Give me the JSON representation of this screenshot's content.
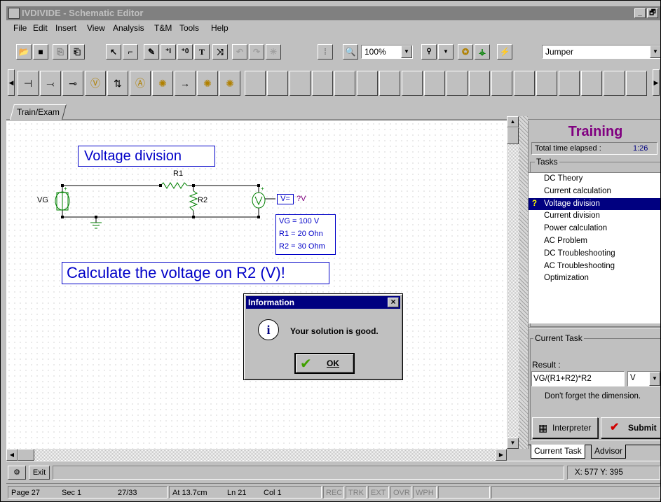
{
  "window": {
    "title": "IVDIVIDE - Schematic Editor",
    "minimize_glyph": "_",
    "maximize_glyph": "🗗"
  },
  "menu": [
    "File",
    "Edit",
    "Insert",
    "View",
    "Analysis",
    "T&M",
    "Tools",
    "Help"
  ],
  "toolbar": {
    "zoom_value": "100%",
    "component_select": "Jumper"
  },
  "tab": {
    "label": "Train/Exam"
  },
  "schematic": {
    "title": "Voltage division",
    "labels": {
      "r1": "R1",
      "r2": "R2",
      "vg": "VG",
      "meter": "V=",
      "unknown": "?V"
    },
    "values": [
      "VG = 100 V",
      "R1 =  20 Ohn",
      "R2 =  30 Ohm"
    ],
    "question": "Calculate the voltage on R2 (V)!"
  },
  "dialog": {
    "title": "Information",
    "message": "Your solution is good.",
    "ok": "OK",
    "close": "×"
  },
  "training": {
    "title": "Training",
    "time_label": "Total time elapsed :",
    "time_value": "1:26",
    "tasks_label": "Tasks",
    "tasks": [
      "DC Theory",
      "Current calculation",
      "Voltage division",
      "Current division",
      "Power calculation",
      "AC Problem",
      "DC Troubleshooting",
      "AC Troubleshooting",
      "Optimization"
    ],
    "selected_task_marker": "?",
    "current_task_label": "Current Task",
    "result_label": "Result :",
    "result_value": "VG/(R1+R2)*R2",
    "unit_value": "V",
    "hint": "Don't forget the dimension.",
    "interpreter": "Interpreter",
    "submit": "Submit",
    "bottom_tabs": [
      "Current Task",
      "Advisor"
    ],
    "colors": {
      "title": "#800080",
      "selected": "#000080"
    }
  },
  "bottombar": {
    "exit": "Exit",
    "coords": "X: 577  Y: 395"
  },
  "statusbar": {
    "page": "Page 27",
    "sec": "Sec 1",
    "pages": "27/33",
    "at": "At 13.7cm",
    "ln": "Ln 21",
    "col": "Col 1",
    "indicators": [
      "REC",
      "TRK",
      "EXT",
      "OVR",
      "WPH"
    ]
  }
}
